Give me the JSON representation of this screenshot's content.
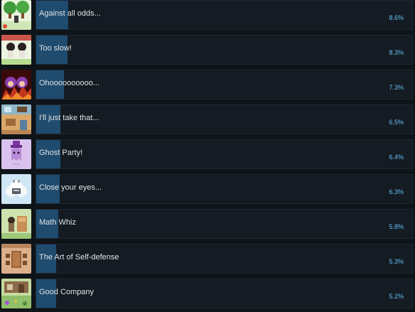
{
  "achievements": [
    {
      "title": "Against all odds...",
      "percent_label": "8.6%",
      "percent": 8.6,
      "icon": "trees-pixel-art-icon"
    },
    {
      "title": "Too slow!",
      "percent_label": "8.3%",
      "percent": 8.3,
      "icon": "two-characters-pixel-art-icon"
    },
    {
      "title": "Ohoooooooooo...",
      "percent_label": "7.3%",
      "percent": 7.3,
      "icon": "purple-haired-characters-fire-icon"
    },
    {
      "title": "I'll just take that...",
      "percent_label": "6.5%",
      "percent": 6.5,
      "icon": "room-interior-pixel-art-icon"
    },
    {
      "title": "Ghost Party!",
      "percent_label": "6.4%",
      "percent": 6.4,
      "icon": "ghost-with-purple-hat-icon"
    },
    {
      "title": "Close your eyes...",
      "percent_label": "6.3%",
      "percent": 6.3,
      "icon": "cloud-creature-icon"
    },
    {
      "title": "Math Whiz",
      "percent_label": "5.8%",
      "percent": 5.8,
      "icon": "character-at-desk-icon"
    },
    {
      "title": "The Art of Self-defense",
      "percent_label": "5.3%",
      "percent": 5.3,
      "icon": "table-room-pixel-art-icon"
    },
    {
      "title": "Good Company",
      "percent_label": "5.2%",
      "percent": 5.2,
      "icon": "garden-house-pixel-art-icon"
    }
  ],
  "colors": {
    "background": "#0f1419",
    "row_background": "#141b23",
    "fill": "#1f4b6e",
    "title_text": "#dfe3e6",
    "percent_text": "#67c1f5"
  }
}
